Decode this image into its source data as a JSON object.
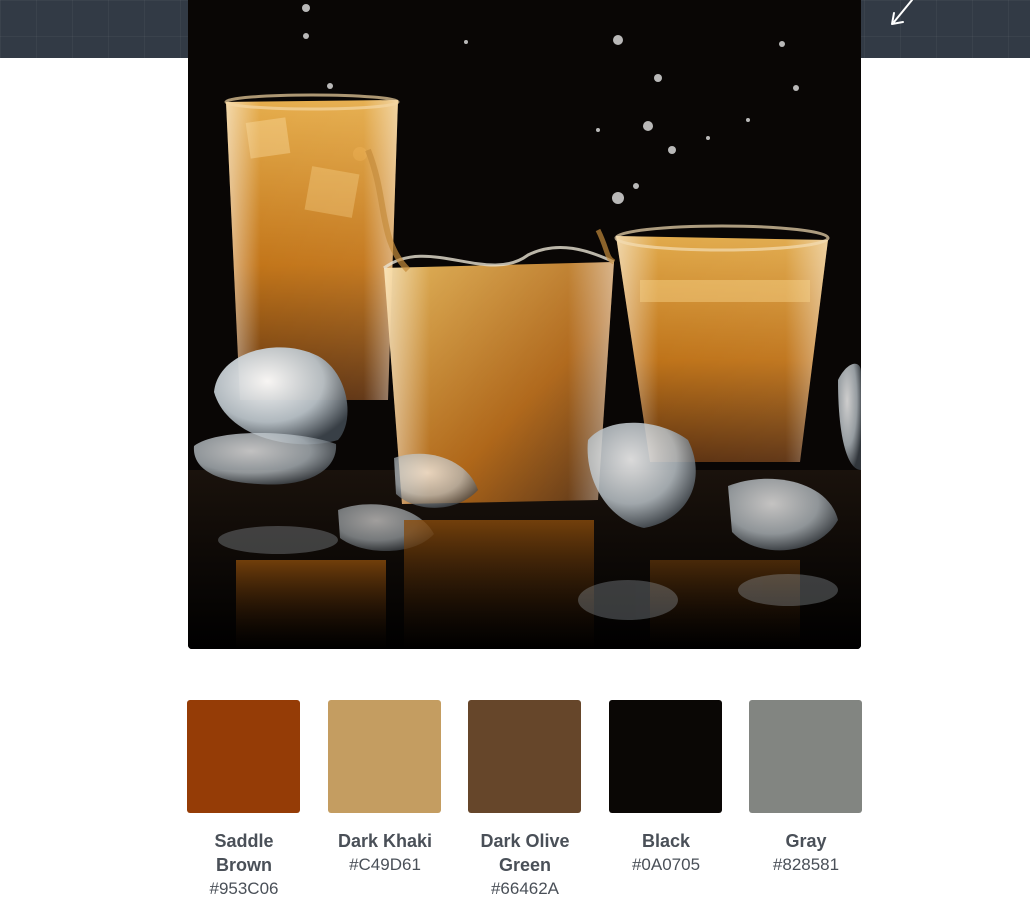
{
  "header": {
    "background": "#323A45",
    "icon": "arrow-down-left-icon"
  },
  "photo": {
    "alt_subject": "three glasses of whiskey with ice"
  },
  "palette": [
    {
      "name": "Saddle Brown",
      "hex": "#953C06",
      "color": "#953C06"
    },
    {
      "name": "Dark Khaki",
      "hex": "#C49D61",
      "color": "#C49D61"
    },
    {
      "name": "Dark Olive Green",
      "hex": "#66462A",
      "color": "#66462A"
    },
    {
      "name": "Black",
      "hex": "#0A0705",
      "color": "#0A0705"
    },
    {
      "name": "Gray",
      "hex": "#828581",
      "color": "#828581"
    }
  ]
}
